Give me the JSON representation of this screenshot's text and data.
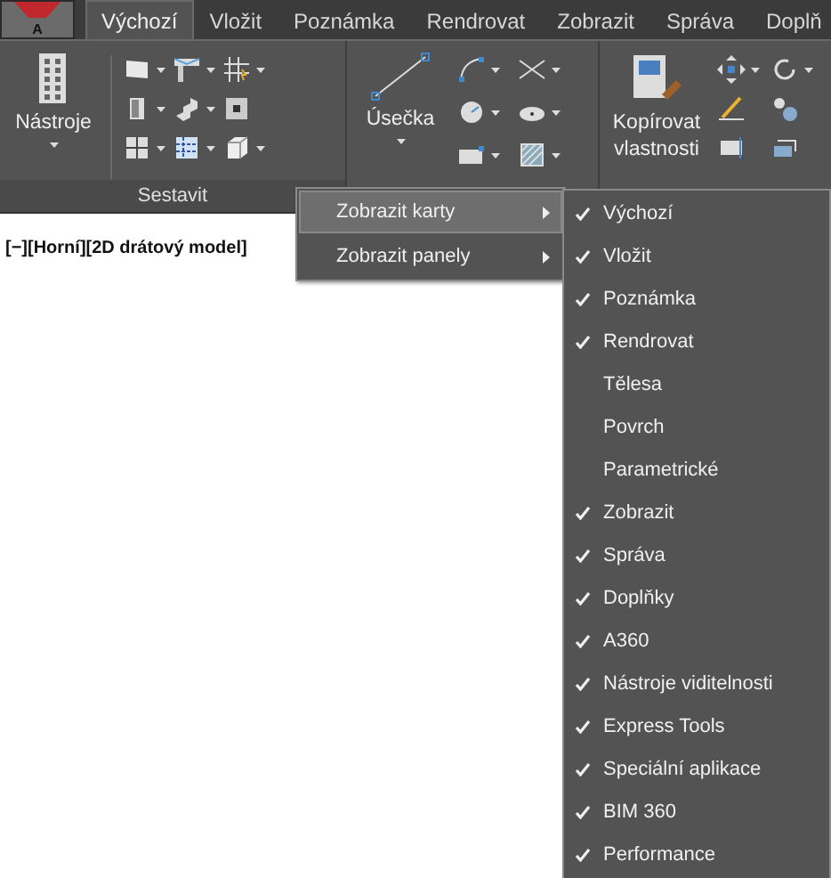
{
  "app_button": {
    "label": "A"
  },
  "tabs": [
    {
      "label": "Výchozí",
      "selected": true
    },
    {
      "label": "Vložit",
      "selected": false
    },
    {
      "label": "Poznámka",
      "selected": false
    },
    {
      "label": "Rendrovat",
      "selected": false
    },
    {
      "label": "Zobrazit",
      "selected": false
    },
    {
      "label": "Správa",
      "selected": false
    },
    {
      "label": "Doplň",
      "selected": false
    }
  ],
  "ribbon": {
    "panels": [
      {
        "big_button": "Nástroje",
        "title": "Sestavit"
      },
      {
        "big_button": "Úsečka"
      },
      {
        "big_button": "Kopírovat vlastnosti"
      }
    ]
  },
  "viewport_label": "[−][Horní][2D drátový model]",
  "context_menu": {
    "items": [
      {
        "label": "Zobrazit karty",
        "selected": true
      },
      {
        "label": "Zobrazit panely",
        "selected": false
      }
    ]
  },
  "submenu": {
    "items": [
      {
        "label": "Výchozí",
        "checked": true
      },
      {
        "label": "Vložit",
        "checked": true
      },
      {
        "label": "Poznámka",
        "checked": true
      },
      {
        "label": "Rendrovat",
        "checked": true
      },
      {
        "label": "Tělesa",
        "checked": false
      },
      {
        "label": "Povrch",
        "checked": false
      },
      {
        "label": "Parametrické",
        "checked": false
      },
      {
        "label": "Zobrazit",
        "checked": true
      },
      {
        "label": "Správa",
        "checked": true
      },
      {
        "label": "Doplňky",
        "checked": true
      },
      {
        "label": "A360",
        "checked": true
      },
      {
        "label": "Nástroje viditelnosti",
        "checked": true
      },
      {
        "label": "Express Tools",
        "checked": true
      },
      {
        "label": "Speciální aplikace",
        "checked": true
      },
      {
        "label": "BIM 360",
        "checked": true
      },
      {
        "label": "Performance",
        "checked": true
      }
    ]
  }
}
